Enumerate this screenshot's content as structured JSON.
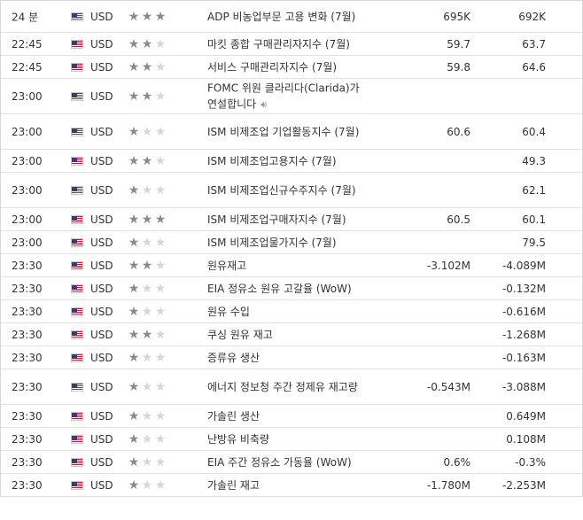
{
  "calendar": {
    "rows": [
      {
        "time": "24 분",
        "currency": "USD",
        "stars": 3,
        "event": "ADP 비농업부문 고용 변화 (7월)",
        "actual": "695K",
        "forecast": "692K",
        "speech": false
      },
      {
        "time": "22:45",
        "currency": "USD",
        "stars": 2,
        "event": "마킷 종합 구매관리자지수 (7월)",
        "actual": "59.7",
        "forecast": "63.7",
        "speech": false
      },
      {
        "time": "22:45",
        "currency": "USD",
        "stars": 2,
        "event": "서비스 구매관리자지수 (7월)",
        "actual": "59.8",
        "forecast": "64.6",
        "speech": false
      },
      {
        "time": "23:00",
        "currency": "USD",
        "stars": 2,
        "event": "FOMC 위원 클라리다(Clarida)가 연설합니다",
        "actual": "",
        "forecast": "",
        "speech": true
      },
      {
        "time": "23:00",
        "currency": "USD",
        "stars": 1,
        "event": "ISM 비제조업 기업활동지수 (7월)",
        "actual": "60.6",
        "forecast": "60.4",
        "speech": false
      },
      {
        "time": "23:00",
        "currency": "USD",
        "stars": 2,
        "event": "ISM 비제조업고용지수 (7월)",
        "actual": "",
        "forecast": "49.3",
        "speech": false
      },
      {
        "time": "23:00",
        "currency": "USD",
        "stars": 1,
        "event": "ISM 비제조업신규수주지수 (7월)",
        "actual": "",
        "forecast": "62.1",
        "speech": false
      },
      {
        "time": "23:00",
        "currency": "USD",
        "stars": 3,
        "event": "ISM 비제조업구매자지수 (7월)",
        "actual": "60.5",
        "forecast": "60.1",
        "speech": false
      },
      {
        "time": "23:00",
        "currency": "USD",
        "stars": 1,
        "event": "ISM 비제조업물가지수 (7월)",
        "actual": "",
        "forecast": "79.5",
        "speech": false
      },
      {
        "time": "23:30",
        "currency": "USD",
        "stars": 2,
        "event": "원유재고",
        "actual": "-3.102M",
        "forecast": "-4.089M",
        "speech": false
      },
      {
        "time": "23:30",
        "currency": "USD",
        "stars": 1,
        "event": "EIA 정유소 원유 고갈율 (WoW)",
        "actual": "",
        "forecast": "-0.132M",
        "speech": false
      },
      {
        "time": "23:30",
        "currency": "USD",
        "stars": 1,
        "event": "원유 수입",
        "actual": "",
        "forecast": "-0.616M",
        "speech": false
      },
      {
        "time": "23:30",
        "currency": "USD",
        "stars": 2,
        "event": "쿠싱 원유 재고",
        "actual": "",
        "forecast": "-1.268M",
        "speech": false
      },
      {
        "time": "23:30",
        "currency": "USD",
        "stars": 1,
        "event": "증류유 생산",
        "actual": "",
        "forecast": "-0.163M",
        "speech": false
      },
      {
        "time": "23:30",
        "currency": "USD",
        "stars": 1,
        "event": "에너지 정보청 주간 정제유 재고량",
        "actual": "-0.543M",
        "forecast": "-3.088M",
        "speech": false
      },
      {
        "time": "23:30",
        "currency": "USD",
        "stars": 1,
        "event": "가솔린 생산",
        "actual": "",
        "forecast": "0.649M",
        "speech": false
      },
      {
        "time": "23:30",
        "currency": "USD",
        "stars": 1,
        "event": "난방유 비축량",
        "actual": "",
        "forecast": "0.108M",
        "speech": false
      },
      {
        "time": "23:30",
        "currency": "USD",
        "stars": 1,
        "event": "EIA 주간 정유소 가동율 (WoW)",
        "actual": "0.6%",
        "forecast": "-0.3%",
        "speech": false
      },
      {
        "time": "23:30",
        "currency": "USD",
        "stars": 1,
        "event": "가솔린 재고",
        "actual": "-1.780M",
        "forecast": "-2.253M",
        "speech": false
      }
    ]
  }
}
